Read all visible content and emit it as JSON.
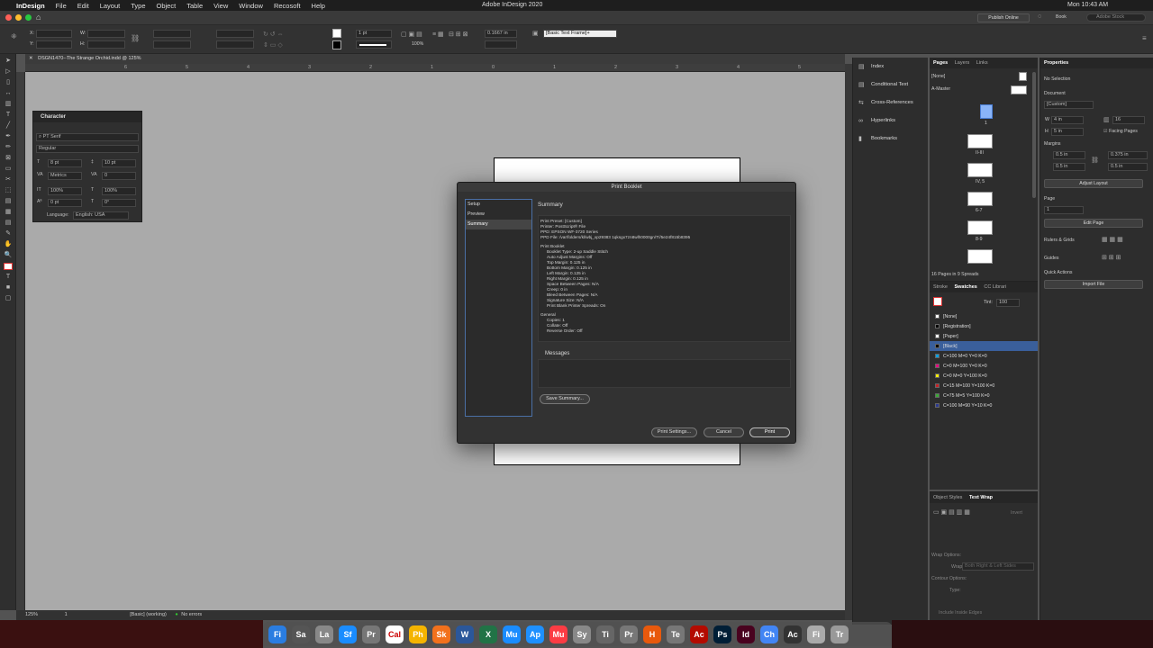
{
  "menubar": {
    "app": "InDesign",
    "items": [
      "File",
      "Edit",
      "Layout",
      "Type",
      "Object",
      "Table",
      "View",
      "Window",
      "Recosoft",
      "Help"
    ],
    "title": "Adobe InDesign 2020",
    "clock": "Mon 10:43 AM"
  },
  "appbar": {
    "publish": "Publish Online",
    "workspace": "Book",
    "search_placeholder": "Adobe Stock"
  },
  "control": {
    "stroke_weight": "1 pt",
    "zoom_pct": "100%",
    "offset": "0.1667 in",
    "frame_style": "[Basic Text Frame]+"
  },
  "document": {
    "tab": "DSGN1470--The Strange Orchid.indd @ 125%",
    "ruler_marks": [
      "6",
      "5",
      "4",
      "3",
      "2",
      "1",
      "0",
      "1",
      "2",
      "3",
      "4",
      "5",
      "6"
    ]
  },
  "status": {
    "zoom": "125%",
    "page": "1",
    "preflight_profile": "[Basic] (working)",
    "errors": "No errors"
  },
  "character": {
    "title": "Character",
    "font": "PT Serif",
    "style": "Regular",
    "size": "8 pt",
    "leading": "10 pt",
    "kerning": "Metrics",
    "tracking": "0",
    "vscale": "100%",
    "hscale": "100%",
    "baseline": "0 pt",
    "skew": "0°",
    "language_label": "Language:",
    "language": "English: USA"
  },
  "shortcuts": [
    "Index",
    "Conditional Text",
    "Cross-References",
    "Hyperlinks",
    "Bookmarks"
  ],
  "pages": {
    "tabs": [
      "Pages",
      "Layers",
      "Links"
    ],
    "none": "[None]",
    "master": "A-Master",
    "spreads": [
      "1",
      "II-III",
      "IV, 5",
      "6-7",
      "8-9"
    ],
    "count": "16 Pages in 9 Spreads"
  },
  "swatches": {
    "tabs": [
      "Stroke",
      "Swatches",
      "CC Librari"
    ],
    "tint_label": "Tint:",
    "tint": "100",
    "items": [
      "[None]",
      "[Registration]",
      "[Paper]",
      "[Black]",
      "C=100 M=0 Y=0 K=0",
      "C=0 M=100 Y=0 K=0",
      "C=0 M=0 Y=100 K=0",
      "C=15 M=100 Y=100 K=0",
      "C=75 M=5 Y=100 K=0",
      "C=100 M=90 Y=10 K=0"
    ],
    "colors": [
      "#ffffff",
      "#000000",
      "#ffffff",
      "#000000",
      "#00a0e3",
      "#e6007e",
      "#ffed00",
      "#c62127",
      "#3aa935",
      "#2b3990"
    ]
  },
  "wrap": {
    "tabs": [
      "Object Styles",
      "Text Wrap"
    ],
    "invert": "Invert",
    "wrap_options": "Wrap Options:",
    "wrap_to_label": "Wrap To:",
    "wrap_to": "Both Right & Left Sides",
    "contour_options": "Contour Options:",
    "type_label": "Type:",
    "include_inside": "Include Inside Edges"
  },
  "properties": {
    "title": "Properties",
    "selection": "No Selection",
    "document_label": "Document",
    "preset": "[Custom]",
    "width": "4 in",
    "height": "5 in",
    "pages": "16",
    "facing": "Facing Pages",
    "margins_label": "Margins",
    "m_top": "0.5 in",
    "m_bottom": "0.5 in",
    "m_inside": "0.375 in",
    "m_outside": "0.5 in",
    "adjust_layout": "Adjust Layout",
    "page_label": "Page",
    "page_value": "1",
    "edit_page": "Edit Page",
    "rulers": "Rulers & Grids",
    "guides": "Guides",
    "quick_actions": "Quick Actions",
    "import_file": "Import File"
  },
  "dialog": {
    "title": "Print Booklet",
    "nav": [
      "Setup",
      "Preview",
      "Summary"
    ],
    "section": "Summary",
    "summary": [
      {
        "t": "Print Preset: [Custom]",
        "i": 0
      },
      {
        "t": "Printer: PostScript® File",
        "i": 0
      },
      {
        "t": "PPD: EPSON WF-3720 Series",
        "i": 0
      },
      {
        "t": "PPD File: /var/folders/kl/wbj_xp29383 1qksgx7zn8wlh0000gn/T//5e24f815b8395",
        "i": 0
      },
      {
        "t": "",
        "i": 0
      },
      {
        "t": "Print Booklet",
        "i": 0
      },
      {
        "t": "Booklet Type: 2-up Saddle Stitch",
        "i": 1
      },
      {
        "t": "Auto Adjust Margins: Off",
        "i": 1
      },
      {
        "t": "Top Margin: 0.125 in",
        "i": 1
      },
      {
        "t": "Bottom Margin: 0.125 in",
        "i": 1
      },
      {
        "t": "Left Margin: 0.125 in",
        "i": 1
      },
      {
        "t": "Right Margin: 0.125 in",
        "i": 1
      },
      {
        "t": "Space Between Pages: N/A",
        "i": 1
      },
      {
        "t": "Creep: 0 in",
        "i": 1
      },
      {
        "t": "Bleed Between Pages: N/A",
        "i": 1
      },
      {
        "t": "Signature Size: N/A",
        "i": 1
      },
      {
        "t": "Print Blank Printer Spreads: On",
        "i": 1
      },
      {
        "t": "",
        "i": 0
      },
      {
        "t": "General",
        "i": 0
      },
      {
        "t": "Copies: 1",
        "i": 1
      },
      {
        "t": "Collate: Off",
        "i": 1
      },
      {
        "t": "Reverse Order: Off",
        "i": 1
      }
    ],
    "messages": "Messages",
    "save_summary": "Save Summary...",
    "print_settings": "Print Settings...",
    "cancel": "Cancel",
    "print": "Print"
  },
  "dock": [
    "Fi",
    "Sa",
    "La",
    "Sf",
    "Pr",
    "Cal",
    "Ph",
    "Sk",
    "W",
    "X",
    "Mu",
    "Ap",
    "Mu",
    "Sy",
    "Ti",
    "Pr",
    "H",
    "Te",
    "Ac",
    "Ps",
    "Id",
    "Ch",
    "Ac",
    "Fi",
    "Tr"
  ],
  "dock_colors": [
    "#2a7de1",
    "#555",
    "#888",
    "#1a8cff",
    "#777",
    "#fff",
    "#f5b400",
    "#f2711c",
    "#2b579a",
    "#217346",
    "#1a8cff",
    "#1e90ff",
    "#fc3c44",
    "#888",
    "#666",
    "#777",
    "#e8590c",
    "#777",
    "#b30b00",
    "#001e36",
    "#49021f",
    "#4285f4",
    "#333",
    "#aaa",
    "#999"
  ]
}
